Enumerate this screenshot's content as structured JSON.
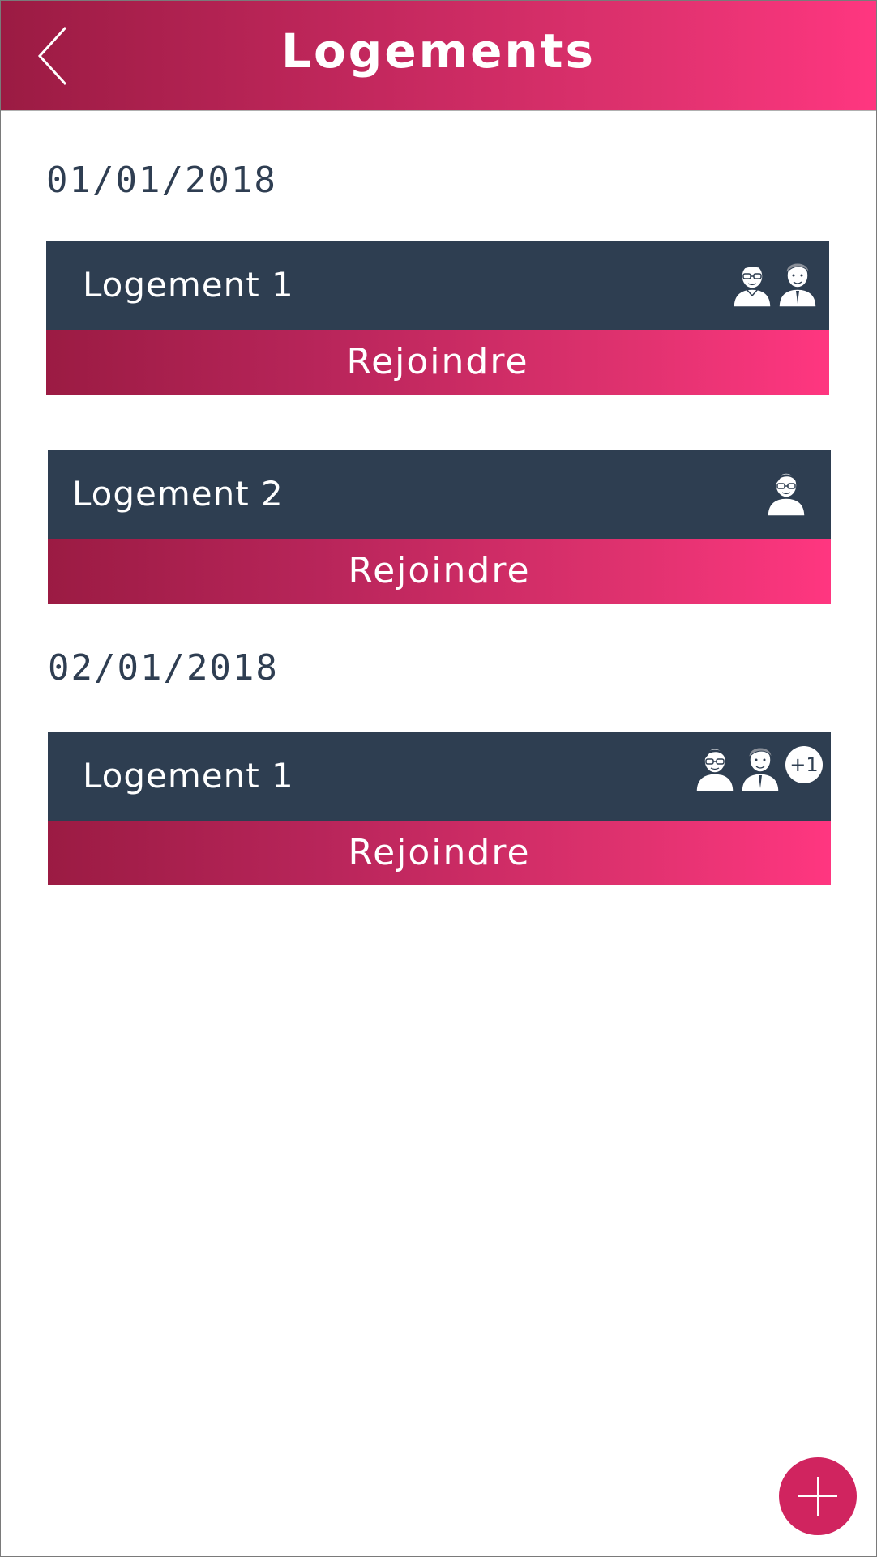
{
  "header": {
    "title": "Logements"
  },
  "sections": [
    {
      "date": "01/01/2018",
      "cards": [
        {
          "name": "Logement 1",
          "join_label": "Rejoindre",
          "avatars": [
            "man-with-glasses-avatar",
            "man-with-tie-avatar"
          ],
          "extra": ""
        },
        {
          "name": "Logement 2",
          "join_label": "Rejoindre",
          "avatars": [
            "woman-with-glasses-avatar"
          ],
          "extra": ""
        }
      ]
    },
    {
      "date": "02/01/2018",
      "cards": [
        {
          "name": "Logement 1",
          "join_label": "Rejoindre",
          "avatars": [
            "woman-with-glasses-avatar",
            "man-with-tie-avatar"
          ],
          "extra": "+1"
        }
      ]
    }
  ],
  "colors": {
    "accent": "#d0245f",
    "card_dark": "#2e3e51",
    "gradient_start": "#9b1b43",
    "gradient_end": "#ff3680"
  }
}
